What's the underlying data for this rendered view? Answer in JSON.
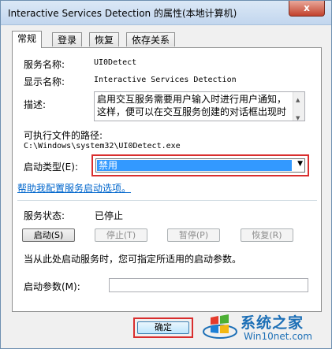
{
  "window": {
    "title": "Interactive Services Detection 的属性(本地计算机)",
    "close_glyph": "x"
  },
  "tabs": [
    {
      "label": "常规",
      "active": true
    },
    {
      "label": "登录",
      "active": false
    },
    {
      "label": "恢复",
      "active": false
    },
    {
      "label": "依存关系",
      "active": false
    }
  ],
  "general": {
    "service_name_label": "服务名称:",
    "service_name_value": "UI0Detect",
    "display_name_label": "显示名称:",
    "display_name_value": "Interactive Services Detection",
    "description_label": "描述:",
    "description_value": "启用交互服务需要用户输入时进行用户通知，这样，便可以在交互服务创建的对话框出现时",
    "exe_path_label": "可执行文件的路径:",
    "exe_path_value": "C:\\Windows\\system32\\UI0Detect.exe",
    "startup_type_label": "启动类型(E):",
    "startup_type_value": "禁用",
    "help_link": "帮助我配置服务启动选项。",
    "service_status_label": "服务状态:",
    "service_status_value": "已停止",
    "buttons": {
      "start": "启动(S)",
      "stop": "停止(T)",
      "pause": "暂停(P)",
      "resume": "恢复(R)"
    },
    "hint_text": "当从此处启动服务时，您可指定所适用的启动参数。",
    "start_params_label": "启动参数(M):",
    "start_params_value": ""
  },
  "footer": {
    "ok_label": "确定"
  },
  "watermark": {
    "title": "系统之家",
    "url": "Win10net.com"
  },
  "colors": {
    "highlight_red": "#d92e2e",
    "selection_blue": "#3399ff",
    "link_blue": "#0066cc",
    "watermark_blue": "#1c6fb6"
  }
}
